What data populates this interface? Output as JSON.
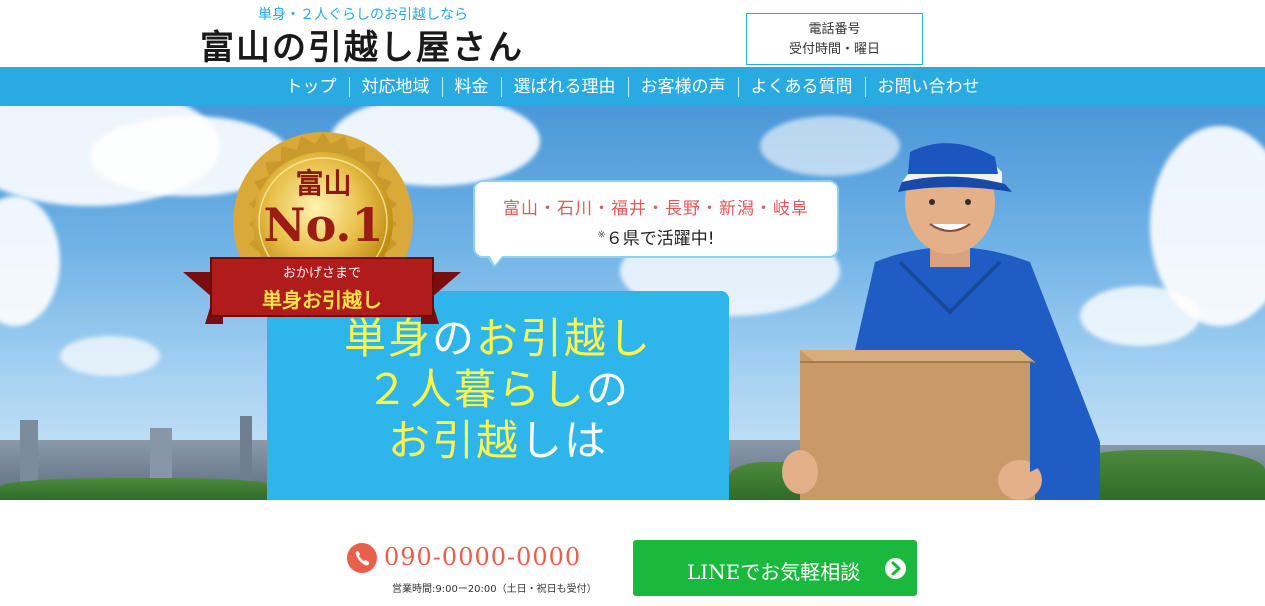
{
  "header": {
    "tagline": "単身・２人ぐらしのお引越しなら",
    "site_title": "富山の引越し屋さん",
    "contact_line1": "電話番号",
    "contact_line2": "受付時間・曜日"
  },
  "nav": {
    "items": [
      "トップ",
      "対応地域",
      "料金",
      "選ばれる理由",
      "お客様の声",
      "よくある質問",
      "お問い合わせ"
    ]
  },
  "hero": {
    "medal_top": "富山",
    "medal_main": "No.1",
    "ribbon_small": "おかげさまで",
    "ribbon_main": "単身お引越し",
    "bubble_areas": "富山・石川・福井・長野・新潟・岐阜",
    "bubble_note_mark": "※",
    "bubble_note": "６県で活躍中!",
    "line1_a": "単身",
    "line1_b": "の",
    "line1_c": "お引越し",
    "line2_a": "２人暮らし",
    "line2_b": "の",
    "line3_a": "お引越",
    "line3_b": "しは"
  },
  "contact": {
    "phone": "090-0000-0000",
    "hours": "営業時間:9:00ー20:00（土日・祝日も受付）",
    "line_button": "LINEでお気軽相談"
  },
  "colors": {
    "accent_blue": "#29abe2",
    "phone_red": "#e8604c",
    "line_green": "#1ab93d",
    "headline_yellow": "#fff34d"
  }
}
